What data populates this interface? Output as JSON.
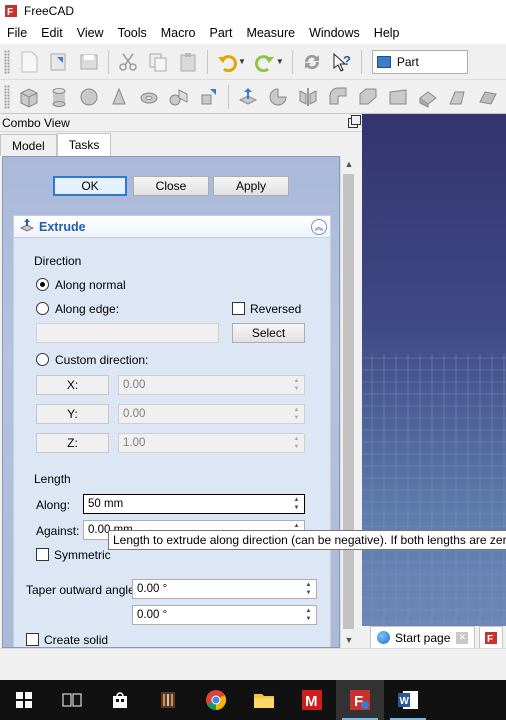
{
  "window": {
    "title": "FreeCAD"
  },
  "menubar": {
    "items": [
      "File",
      "Edit",
      "View",
      "Tools",
      "Macro",
      "Part",
      "Measure",
      "Windows",
      "Help"
    ]
  },
  "toolbar": {
    "workbench": "Part"
  },
  "combo_view": {
    "title": "Combo View",
    "tabs": [
      "Model",
      "Tasks"
    ],
    "active_tab": "Tasks"
  },
  "task": {
    "buttons": {
      "ok": "OK",
      "close": "Close",
      "apply": "Apply"
    },
    "panel_title": "Extrude",
    "direction": {
      "section_label": "Direction",
      "along_normal": "Along normal",
      "along_edge": "Along edge:",
      "reversed": "Reversed",
      "edge_value": "",
      "select_button": "Select",
      "custom_direction": "Custom direction:",
      "selected_option": "Along normal",
      "x_label": "X:",
      "x_value": "0.00",
      "y_label": "Y:",
      "y_value": "0.00",
      "z_label": "Z:",
      "z_value": "1.00"
    },
    "length": {
      "section_label": "Length",
      "along_label": "Along:",
      "along_value": "50 mm",
      "against_label": "Against:",
      "against_value": "0.00 mm",
      "symmetric": "Symmetric"
    },
    "taper": {
      "label": "Taper outward angle",
      "value1": "0.00 °",
      "value2": "0.00 °"
    },
    "create_solid": "Create solid"
  },
  "tooltip": "Length to extrude along direction (can be negative). If both lengths are zero",
  "doc_tabs": {
    "start_page": "Start page"
  },
  "colors": {
    "accent": "#3078d6",
    "panel_title": "#1f5fb3",
    "viewport_top": "#33336e",
    "viewport_bottom": "#6f88b8"
  }
}
